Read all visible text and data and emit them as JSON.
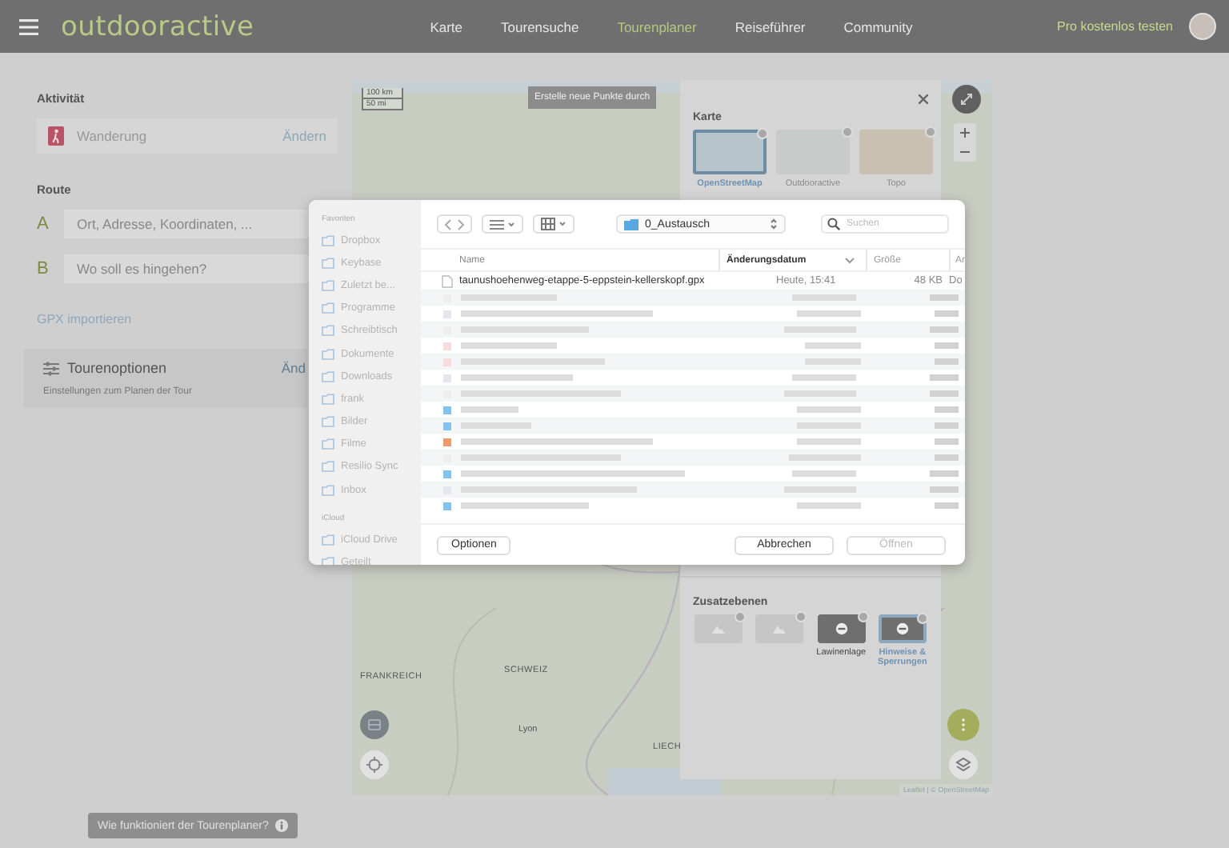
{
  "nav": {
    "logo": "outdooractive",
    "links": [
      {
        "label": "Karte",
        "selected": false
      },
      {
        "label": "Tourensuche",
        "selected": false
      },
      {
        "label": "Tourenplaner",
        "selected": true
      },
      {
        "label": "Reiseführer",
        "selected": false
      },
      {
        "label": "Community",
        "selected": false
      }
    ],
    "cta": "Pro kostenlos testen"
  },
  "sidebar": {
    "activity_heading": "Aktivität",
    "activity": "Wanderung",
    "change_link": "Ändern",
    "route_heading": "Route",
    "waypoints": [
      {
        "letter": "A",
        "placeholder": "Ort, Adresse, Koordinaten, ..."
      },
      {
        "letter": "B",
        "placeholder": "Wo soll es hingehen?"
      }
    ],
    "gpx_link": "GPX importieren",
    "options": {
      "title": "Tourenoptionen",
      "link": "Änd",
      "description": "Einstellungen zum Planen der Tour"
    },
    "help_button": "Wie funktioniert der Tourenplaner?"
  },
  "map": {
    "scale": [
      "100 km",
      "50 mi"
    ],
    "hint": "Erstelle neue Punkte durch",
    "labels": [
      {
        "text": "FRANKREICH",
        "kind": "country"
      },
      {
        "text": "SCHWEIZ",
        "kind": "country"
      },
      {
        "text": "LIECH",
        "kind": "country"
      },
      {
        "text": "Lyon",
        "kind": "city"
      }
    ],
    "attribution": "Leaflet | © OpenStreetMap"
  },
  "layers_panel": {
    "map_heading": "Karte",
    "base_maps": [
      {
        "label": "OpenStreetMap",
        "selected": true
      },
      {
        "label": "Outdooractive",
        "selected": false
      },
      {
        "label": "Topo",
        "selected": false
      }
    ],
    "overlays_heading": "Zusatzebenen",
    "overlays": [
      {
        "kind": "light",
        "selected": false
      },
      {
        "kind": "light",
        "selected": false
      },
      {
        "kind": "dark",
        "label": "Lawinenlage",
        "selected": false
      },
      {
        "kind": "dark",
        "label": "Hinweise & Sperrungen",
        "selected": true
      }
    ]
  },
  "file_dialog": {
    "favorites_heading": "Favoriten",
    "favorites": [
      "Dropbox",
      "Keybase",
      "Zuletzt be...",
      "Programme",
      "Schreibtisch",
      "Dokumente",
      "Downloads",
      "frank",
      "Bilder",
      "Filme",
      "Resilio Sync",
      "Inbox"
    ],
    "icloud_heading": "iCloud",
    "icloud": [
      "iCloud Drive",
      "Geteilt"
    ],
    "folder": "0_Austausch",
    "search_placeholder": "Suchen",
    "columns": [
      "Name",
      "Änderungsdatum",
      "Größe",
      "Ar"
    ],
    "files": [
      {
        "name": "taunushoehenweg-etappe-5-eppstein-kellerskopf.gpx",
        "date": "Heute, 15:41",
        "size": "48 KB",
        "kind": "Do"
      }
    ],
    "buttons": [
      {
        "label": "Optionen",
        "disabled": false
      },
      {
        "label": "Abbrechen",
        "disabled": false
      },
      {
        "label": "Öffnen",
        "disabled": true
      }
    ]
  }
}
